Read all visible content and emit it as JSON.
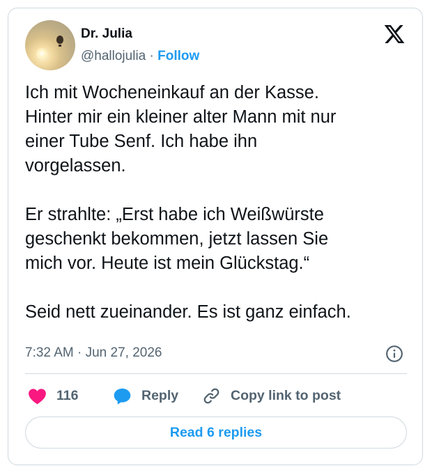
{
  "author": {
    "name": "Dr. Julia  ",
    "handle": "@hallojulia",
    "separator": "·",
    "follow_label": "Follow"
  },
  "post": {
    "text": "Ich mit Wocheneinkauf an der Kasse.\nHinter mir ein kleiner alter Mann mit nur\neiner Tube Senf. Ich habe ihn\nvorgelassen.\n\nEr strahlte: „Erst habe ich Weißwürste\ngeschenkt bekommen, jetzt lassen Sie\nmich vor. Heute ist mein Glückstag.“\n\nSeid nett zueinander. Es ist ganz einfach.",
    "time": "7:32 AM",
    "date_separator": "·",
    "date": "Jun 27, 2026"
  },
  "actions": {
    "likes": "116",
    "reply_label": "Reply",
    "copy_label": "Copy link to post"
  },
  "read_replies_label": "Read 6 replies",
  "icons": {
    "logo": "x-logo-icon",
    "info": "info-icon",
    "like": "heart-icon",
    "reply": "speech-bubble-icon",
    "copy": "link-icon"
  },
  "colors": {
    "accent": "#1d9bf0",
    "like": "#f91880",
    "text": "#0f1419",
    "secondary": "#536471",
    "border": "#cfd9de"
  }
}
